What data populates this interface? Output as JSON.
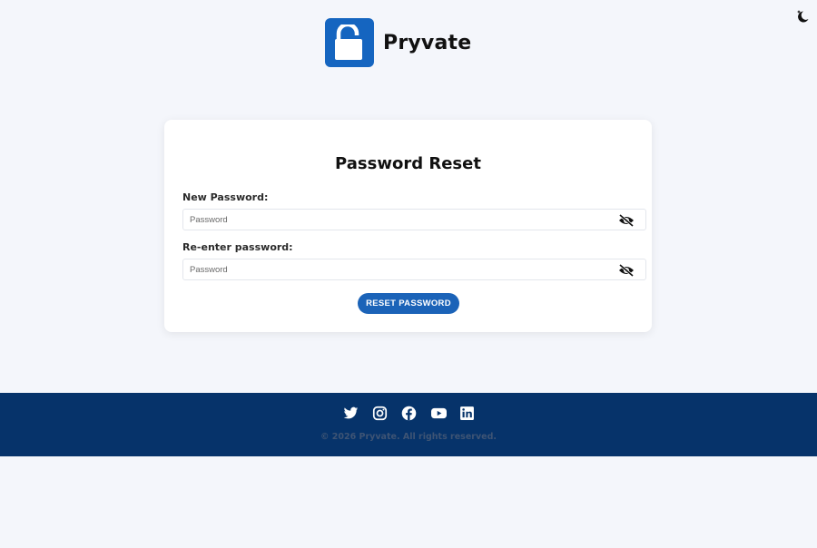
{
  "brand": {
    "name": "Pryvate",
    "logo_icon": "padlock-open-icon",
    "accent_color": "#1565c0"
  },
  "theme_toggle": {
    "icon": "moon-stars-icon"
  },
  "form": {
    "title": "Password Reset",
    "fields": [
      {
        "label": "New Password:",
        "placeholder": "Password",
        "value": "",
        "toggle_icon": "eye-slash-icon"
      },
      {
        "label": "Re-enter password:",
        "placeholder": "Password",
        "value": "",
        "toggle_icon": "eye-slash-icon"
      }
    ],
    "submit_label": "RESET PASSWORD",
    "submit_color": "#1b63b8"
  },
  "footer": {
    "background_color": "#06336a",
    "social_icons": [
      "twitter-icon",
      "instagram-icon",
      "facebook-icon",
      "youtube-icon",
      "linkedin-icon"
    ],
    "copyright": "© 2026 Pryvate. All rights reserved."
  }
}
